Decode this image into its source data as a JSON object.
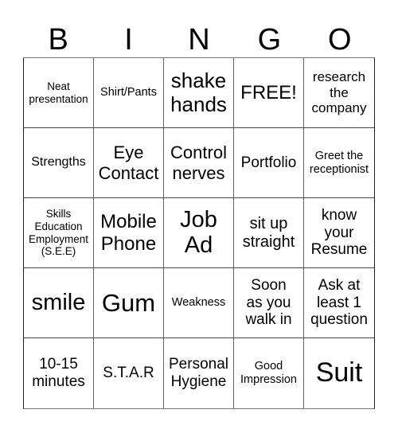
{
  "header": {
    "letters": [
      "B",
      "I",
      "N",
      "G",
      "O"
    ]
  },
  "card": {
    "rows": [
      [
        "Neat\npresentation",
        "Shirt/Pants",
        "shake\nhands",
        "FREE!",
        "research\nthe\ncompany"
      ],
      [
        "Strengths",
        "Eye\nContact",
        "Control\nnerves",
        "Portfolio",
        "Greet the\nreceptionist"
      ],
      [
        "Skills\nEducation\nEmployment\n(S.E.E)",
        "Mobile\nPhone",
        "Job\nAd",
        "sit up\nstraight",
        "know\nyour\nResume"
      ],
      [
        "smile",
        "Gum",
        "Weakness",
        "Soon\nas you\nwalk in",
        "Ask at\nleast 1\nquestion"
      ],
      [
        "10-15\nminutes",
        "S.T.A.R",
        "Personal\nHygiene",
        "Good\nImpression",
        "Suit"
      ]
    ],
    "free_space": "FREE!"
  }
}
